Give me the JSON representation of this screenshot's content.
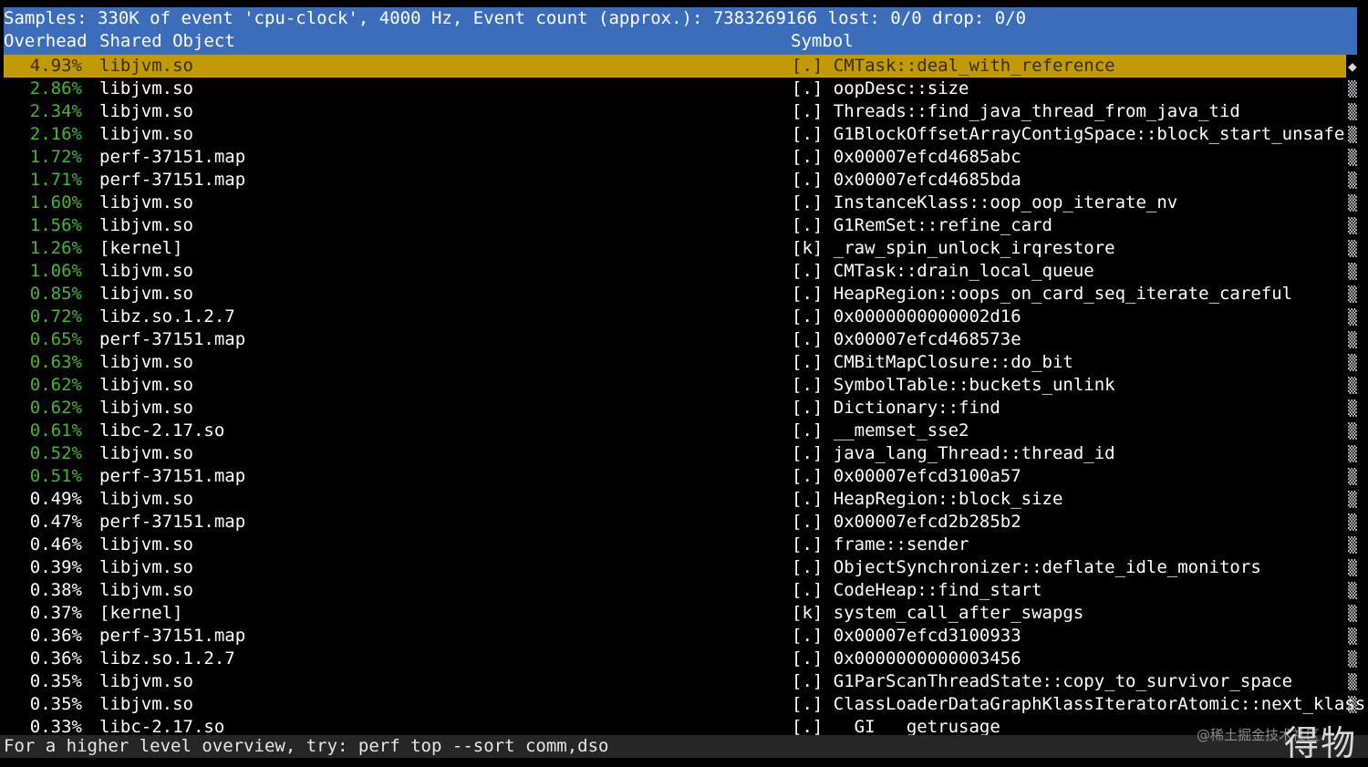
{
  "header": {
    "samples_line": "Samples: 330K of event 'cpu-clock', 4000 Hz, Event count (approx.): 7383269166 lost: 0/0 drop: 0/0",
    "col_overhead": "Overhead",
    "col_shared_object": "Shared Object",
    "col_symbol": "Symbol"
  },
  "colors": {
    "header_bg": "#3b6dbb",
    "selected_bg": "#c29a06",
    "green_pct": "#45b52e",
    "white_pct": "#ffffff"
  },
  "rows": [
    {
      "overhead": "4.93%",
      "dso": "libjvm.so",
      "symbol": "[.] CMTask::deal_with_reference",
      "scroll": "◆"
    },
    {
      "overhead": "2.86%",
      "dso": "libjvm.so",
      "symbol": "[.] oopDesc::size",
      "scroll": "▒"
    },
    {
      "overhead": "2.34%",
      "dso": "libjvm.so",
      "symbol": "[.] Threads::find_java_thread_from_java_tid",
      "scroll": "▒"
    },
    {
      "overhead": "2.16%",
      "dso": "libjvm.so",
      "symbol": "[.] G1BlockOffsetArrayContigSpace::block_start_unsafe",
      "scroll": "▒"
    },
    {
      "overhead": "1.72%",
      "dso": "perf-37151.map",
      "symbol": "[.] 0x00007efcd4685abc",
      "scroll": "▒"
    },
    {
      "overhead": "1.71%",
      "dso": "perf-37151.map",
      "symbol": "[.] 0x00007efcd4685bda",
      "scroll": "▒"
    },
    {
      "overhead": "1.60%",
      "dso": "libjvm.so",
      "symbol": "[.] InstanceKlass::oop_oop_iterate_nv",
      "scroll": "▒"
    },
    {
      "overhead": "1.56%",
      "dso": "libjvm.so",
      "symbol": "[.] G1RemSet::refine_card",
      "scroll": "▒"
    },
    {
      "overhead": "1.26%",
      "dso": "[kernel]",
      "symbol": "[k] _raw_spin_unlock_irqrestore",
      "scroll": "▒"
    },
    {
      "overhead": "1.06%",
      "dso": "libjvm.so",
      "symbol": "[.] CMTask::drain_local_queue",
      "scroll": "▒"
    },
    {
      "overhead": "0.85%",
      "dso": "libjvm.so",
      "symbol": "[.] HeapRegion::oops_on_card_seq_iterate_careful",
      "scroll": "▒"
    },
    {
      "overhead": "0.72%",
      "dso": "libz.so.1.2.7",
      "symbol": "[.] 0x0000000000002d16",
      "scroll": "▒"
    },
    {
      "overhead": "0.65%",
      "dso": "perf-37151.map",
      "symbol": "[.] 0x00007efcd468573e",
      "scroll": "▒"
    },
    {
      "overhead": "0.63%",
      "dso": "libjvm.so",
      "symbol": "[.] CMBitMapClosure::do_bit",
      "scroll": "▒"
    },
    {
      "overhead": "0.62%",
      "dso": "libjvm.so",
      "symbol": "[.] SymbolTable::buckets_unlink",
      "scroll": "▒"
    },
    {
      "overhead": "0.62%",
      "dso": "libjvm.so",
      "symbol": "[.] Dictionary::find",
      "scroll": "▒"
    },
    {
      "overhead": "0.61%",
      "dso": "libc-2.17.so",
      "symbol": "[.] __memset_sse2",
      "scroll": "▒"
    },
    {
      "overhead": "0.52%",
      "dso": "libjvm.so",
      "symbol": "[.] java_lang_Thread::thread_id",
      "scroll": "▒"
    },
    {
      "overhead": "0.51%",
      "dso": "perf-37151.map",
      "symbol": "[.] 0x00007efcd3100a57",
      "scroll": "▒"
    },
    {
      "overhead": "0.49%",
      "dso": "libjvm.so",
      "symbol": "[.] HeapRegion::block_size",
      "scroll": "▒"
    },
    {
      "overhead": "0.47%",
      "dso": "perf-37151.map",
      "symbol": "[.] 0x00007efcd2b285b2",
      "scroll": "▒"
    },
    {
      "overhead": "0.46%",
      "dso": "libjvm.so",
      "symbol": "[.] frame::sender",
      "scroll": "▒"
    },
    {
      "overhead": "0.39%",
      "dso": "libjvm.so",
      "symbol": "[.] ObjectSynchronizer::deflate_idle_monitors",
      "scroll": "▒"
    },
    {
      "overhead": "0.38%",
      "dso": "libjvm.so",
      "symbol": "[.] CodeHeap::find_start",
      "scroll": "▒"
    },
    {
      "overhead": "0.37%",
      "dso": "[kernel]",
      "symbol": "[k] system_call_after_swapgs",
      "scroll": "▒"
    },
    {
      "overhead": "0.36%",
      "dso": "perf-37151.map",
      "symbol": "[.] 0x00007efcd3100933",
      "scroll": "▒"
    },
    {
      "overhead": "0.36%",
      "dso": "libz.so.1.2.7",
      "symbol": "[.] 0x0000000000003456",
      "scroll": "▒"
    },
    {
      "overhead": "0.35%",
      "dso": "libjvm.so",
      "symbol": "[.] G1ParScanThreadState::copy_to_survivor_space",
      "scroll": "▒"
    },
    {
      "overhead": "0.35%",
      "dso": "libjvm.so",
      "symbol": "[.] ClassLoaderDataGraphKlassIteratorAtomic::next_klass",
      "scroll": "▒"
    },
    {
      "overhead": "0.33%",
      "dso": "libc-2.17.so",
      "symbol": "[.] __GI___getrusage",
      "scroll": ""
    }
  ],
  "footer": {
    "hint": "For a higher level overview, try: perf top --sort comm,dso"
  },
  "watermark": {
    "small": "@稀土掘金技术社区",
    "big": "得物"
  }
}
